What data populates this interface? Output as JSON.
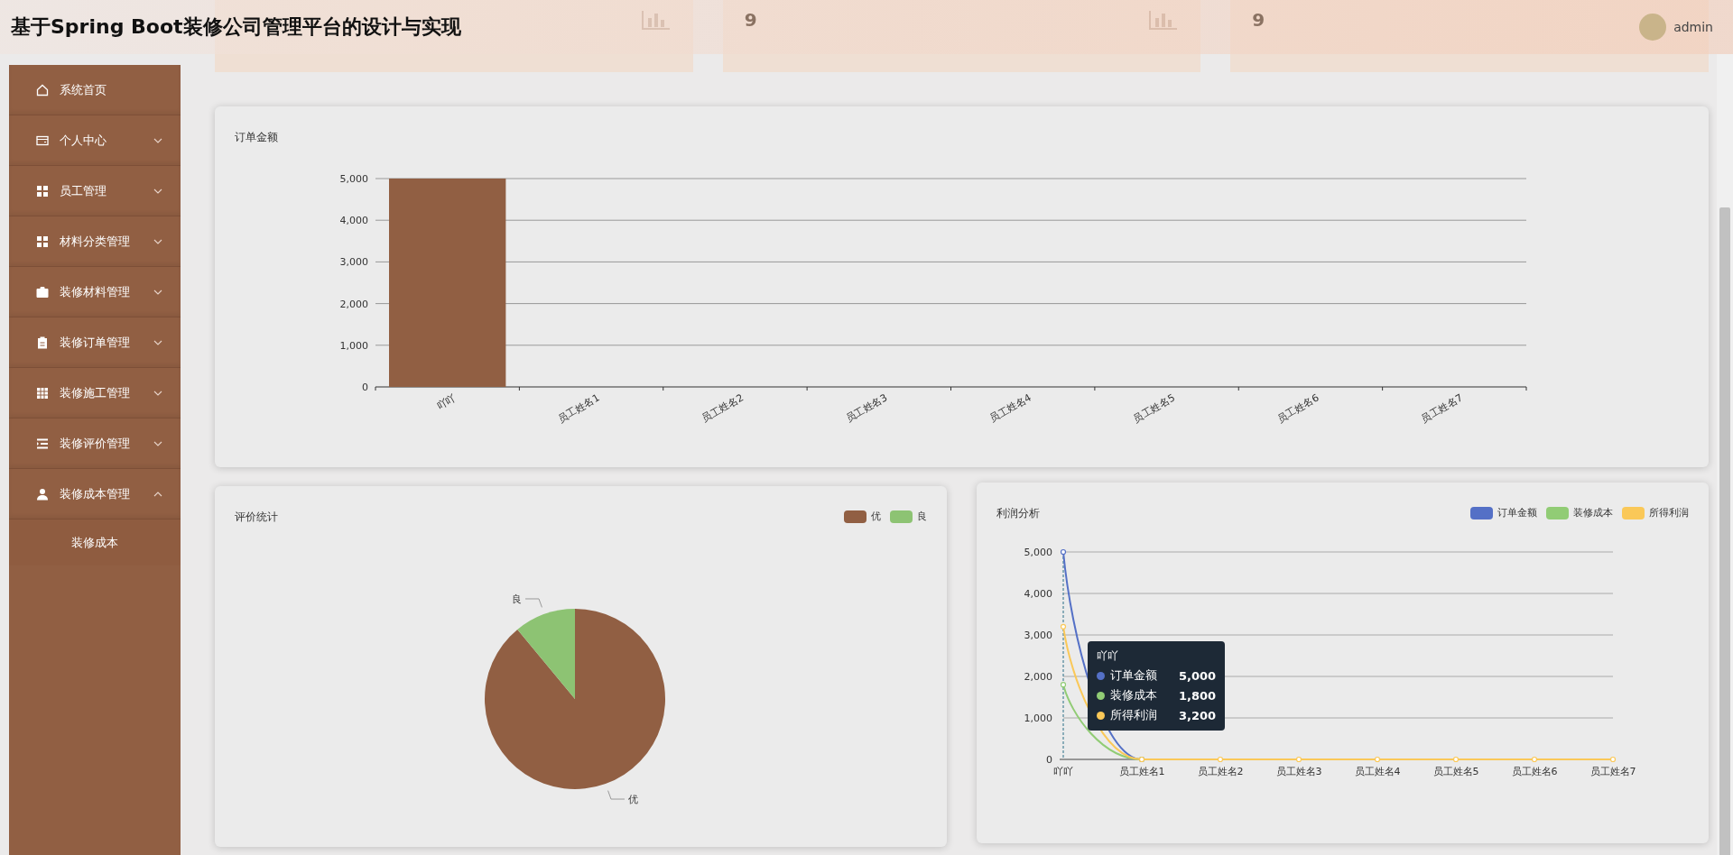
{
  "header": {
    "title": "基于Spring Boot装修公司管理平台的设计与实现",
    "user": {
      "name": "admin"
    }
  },
  "stat_cards": [
    {
      "kind": "icon_only"
    },
    {
      "kind": "full",
      "value": "9"
    },
    {
      "kind": "value_only",
      "value": "9"
    }
  ],
  "sidebar": {
    "items": [
      {
        "label": "系统首页",
        "kind": "link"
      },
      {
        "label": "个人中心",
        "kind": "menu",
        "expanded": false
      },
      {
        "label": "员工管理",
        "kind": "menu",
        "expanded": false
      },
      {
        "label": "材料分类管理",
        "kind": "menu",
        "expanded": false
      },
      {
        "label": "装修材料管理",
        "kind": "menu",
        "expanded": false
      },
      {
        "label": "装修订单管理",
        "kind": "menu",
        "expanded": false
      },
      {
        "label": "装修施工管理",
        "kind": "menu",
        "expanded": false
      },
      {
        "label": "装修评价管理",
        "kind": "menu",
        "expanded": false
      },
      {
        "label": "装修成本管理",
        "kind": "menu",
        "expanded": true,
        "children": [
          {
            "label": "装修成本"
          }
        ]
      }
    ]
  },
  "order_chart": {
    "title": "订单金额",
    "chart_data": {
      "type": "bar",
      "categories": [
        "吖吖",
        "员工姓名1",
        "员工姓名2",
        "员工姓名3",
        "员工姓名4",
        "员工姓名5",
        "员工姓名6",
        "员工姓名7"
      ],
      "series": [
        {
          "color": "#915f43",
          "values": [
            5000,
            0,
            0,
            0,
            0,
            0,
            0,
            0
          ]
        }
      ],
      "grid": true,
      "ylim": [
        0,
        5000
      ],
      "yticks": [
        {
          "value": 0,
          "label": "0"
        },
        {
          "value": 1000,
          "label": "1,000"
        },
        {
          "value": 2000,
          "label": "2,000"
        },
        {
          "value": 3000,
          "label": "3,000"
        },
        {
          "value": 4000,
          "label": "4,000"
        },
        {
          "value": 5000,
          "label": "5,000"
        }
      ]
    }
  },
  "rating_chart": {
    "title": "评价统计",
    "chart_data": {
      "type": "pie",
      "categories": [
        "优",
        "良"
      ],
      "series": [
        {
          "values": [
            89,
            11
          ]
        }
      ],
      "colors": [
        "#915f43",
        "#8dc373"
      ]
    }
  },
  "profit_chart": {
    "title": "利润分析",
    "chart_data": {
      "type": "line",
      "categories": [
        "吖吖",
        "员工姓名1",
        "员工姓名2",
        "员工姓名3",
        "员工姓名4",
        "员工姓名5",
        "员工姓名6",
        "员工姓名7"
      ],
      "series": [
        {
          "name": "订单金额",
          "color": "#5470c6",
          "marker": true,
          "values": [
            5000,
            0,
            null,
            null,
            null,
            null,
            null,
            null
          ]
        },
        {
          "name": "装修成本",
          "color": "#91cc75",
          "marker": true,
          "values": [
            1800,
            0,
            null,
            null,
            null,
            null,
            null,
            null
          ]
        },
        {
          "name": "所得利润",
          "color": "#fac858",
          "marker": true,
          "values": [
            3200,
            0,
            0,
            0,
            0,
            0,
            0,
            0
          ]
        }
      ],
      "grid": true,
      "ylim": [
        0,
        5000
      ],
      "yticks": [
        {
          "value": 0,
          "label": "0"
        },
        {
          "value": 1000,
          "label": "1,000"
        },
        {
          "value": 2000,
          "label": "2,000"
        },
        {
          "value": 3000,
          "label": "3,000"
        },
        {
          "value": 4000,
          "label": "4,000"
        },
        {
          "value": 5000,
          "label": "5,000"
        }
      ]
    },
    "tooltip": {
      "title": "吖吖",
      "rows": [
        {
          "name": "订单金额",
          "value": "5,000",
          "color": "#5470c6"
        },
        {
          "name": "装修成本",
          "value": "1,800",
          "color": "#91cc75"
        },
        {
          "name": "所得利润",
          "value": "3,200",
          "color": "#fac858"
        }
      ]
    }
  }
}
